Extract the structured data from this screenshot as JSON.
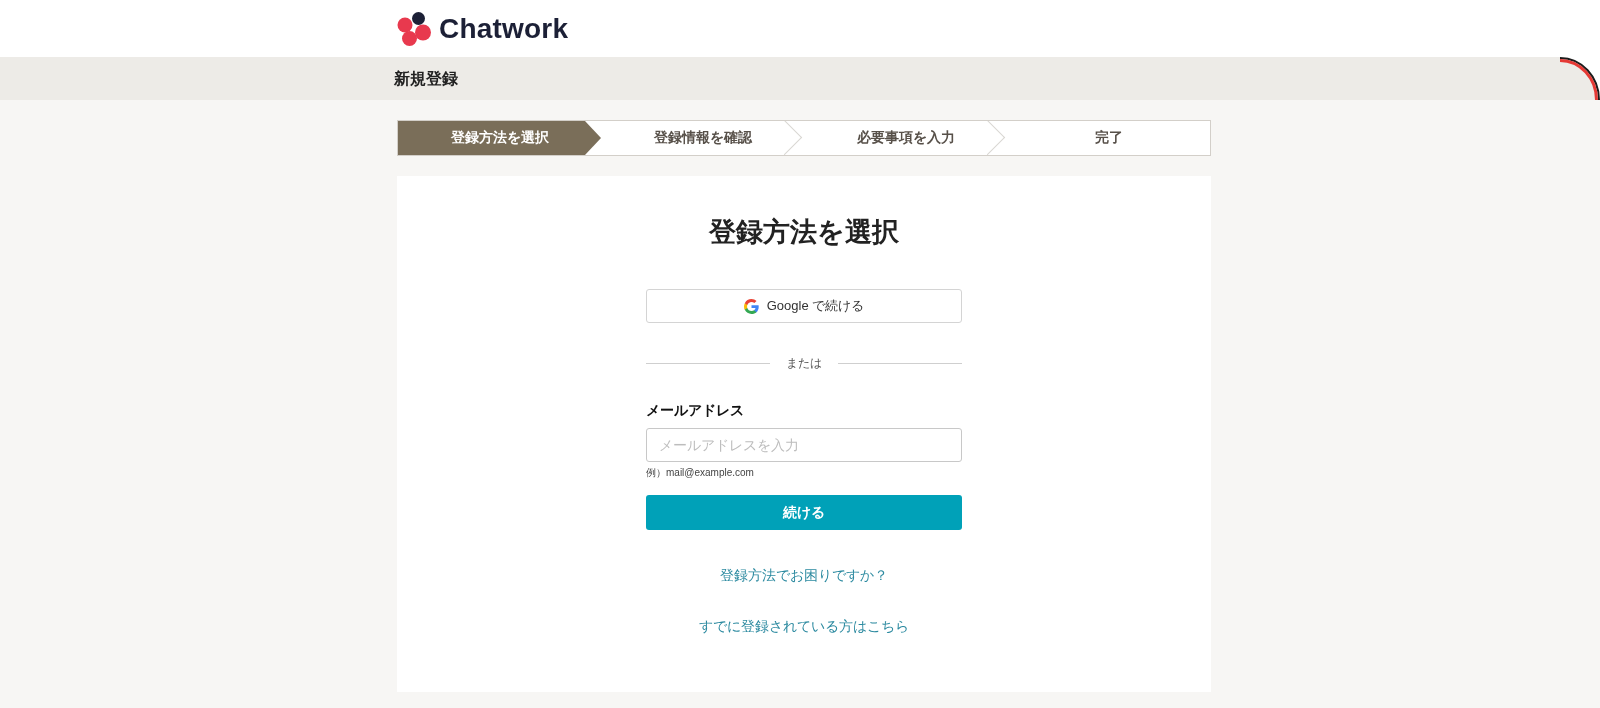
{
  "header": {
    "logo_text": "Chatwork"
  },
  "title_bar": {
    "title": "新規登録"
  },
  "steps": [
    {
      "label": "登録方法を選択",
      "selected": true
    },
    {
      "label": "登録情報を確認",
      "selected": false
    },
    {
      "label": "必要事項を入力",
      "selected": false
    },
    {
      "label": "完了",
      "selected": false
    }
  ],
  "card": {
    "title": "登録方法を選択",
    "google_button": "Google で続ける",
    "divider_text": "または",
    "email_field": {
      "label": "メールアドレス",
      "placeholder": "メールアドレスを入力",
      "hint": "例）mail@example.com"
    },
    "submit_button": "続ける",
    "links": [
      "登録方法でお困りですか？",
      "すでに登録されている方はこちら"
    ]
  }
}
